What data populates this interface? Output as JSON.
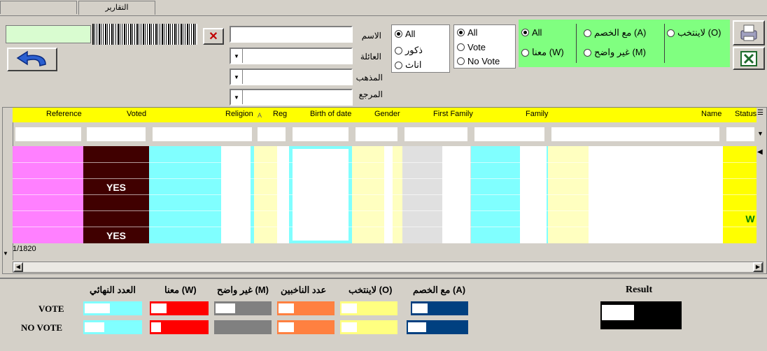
{
  "tabs": {
    "left": "",
    "reports": "التقارير"
  },
  "form": {
    "name_label": "الاسم",
    "family_label": "العائلة",
    "religion_label": "المذهب",
    "marja_label": "المرجع",
    "name_value": "",
    "family_value": "",
    "religion_value": "",
    "marja_value": ""
  },
  "gender_group": {
    "all": "All",
    "male": "ذكور",
    "female": "اناث",
    "selected": "All"
  },
  "vote_group": {
    "all": "All",
    "vote": "Vote",
    "novote": "No Vote",
    "selected": "All"
  },
  "status_group": {
    "all": "All",
    "with": "مع الخصم (A)",
    "no_elect": "لاينتخب (O)",
    "ours": "معنا (W)",
    "unclear": "غير واضح (M)",
    "selected": "All"
  },
  "grid": {
    "headers": {
      "reference": "Reference",
      "voted": "Voted",
      "religion": "Religion",
      "religion_marker": "A",
      "reg": "Reg",
      "birth": "Birth of date",
      "gender": "Gender",
      "first_family": "First Family",
      "family": "Family",
      "name": "Name",
      "status": "Status"
    },
    "rows": [
      {
        "voted": "",
        "status": ""
      },
      {
        "voted": "",
        "status": ""
      },
      {
        "voted": "YES",
        "status": ""
      },
      {
        "voted": "",
        "status": ""
      },
      {
        "voted": "",
        "status": "W"
      },
      {
        "voted": "YES",
        "status": ""
      }
    ],
    "record_counter": "1/1820"
  },
  "summary": {
    "headers": {
      "final": "العدد النهائي",
      "ours": "معنا (W)",
      "unclear": "غير واضح (M)",
      "voters": "عدد الناخبين",
      "no_elect": "لاينتخب (O)",
      "with": "مع الخصم (A)"
    },
    "rows": {
      "vote": "VOTE",
      "novote": "NO VOTE"
    },
    "result_label": "Result"
  },
  "colors": {
    "pink": "#ff80ff",
    "maroon": "#400000",
    "cyan": "#80ffff",
    "lightyellow": "#ffffc0",
    "gray": "#e0e0e0",
    "yellow": "#ffff00",
    "red": "#ff0000",
    "orange": "#ff8040",
    "navy": "#004080",
    "darkgray": "#808080",
    "green": "#80ff80"
  }
}
